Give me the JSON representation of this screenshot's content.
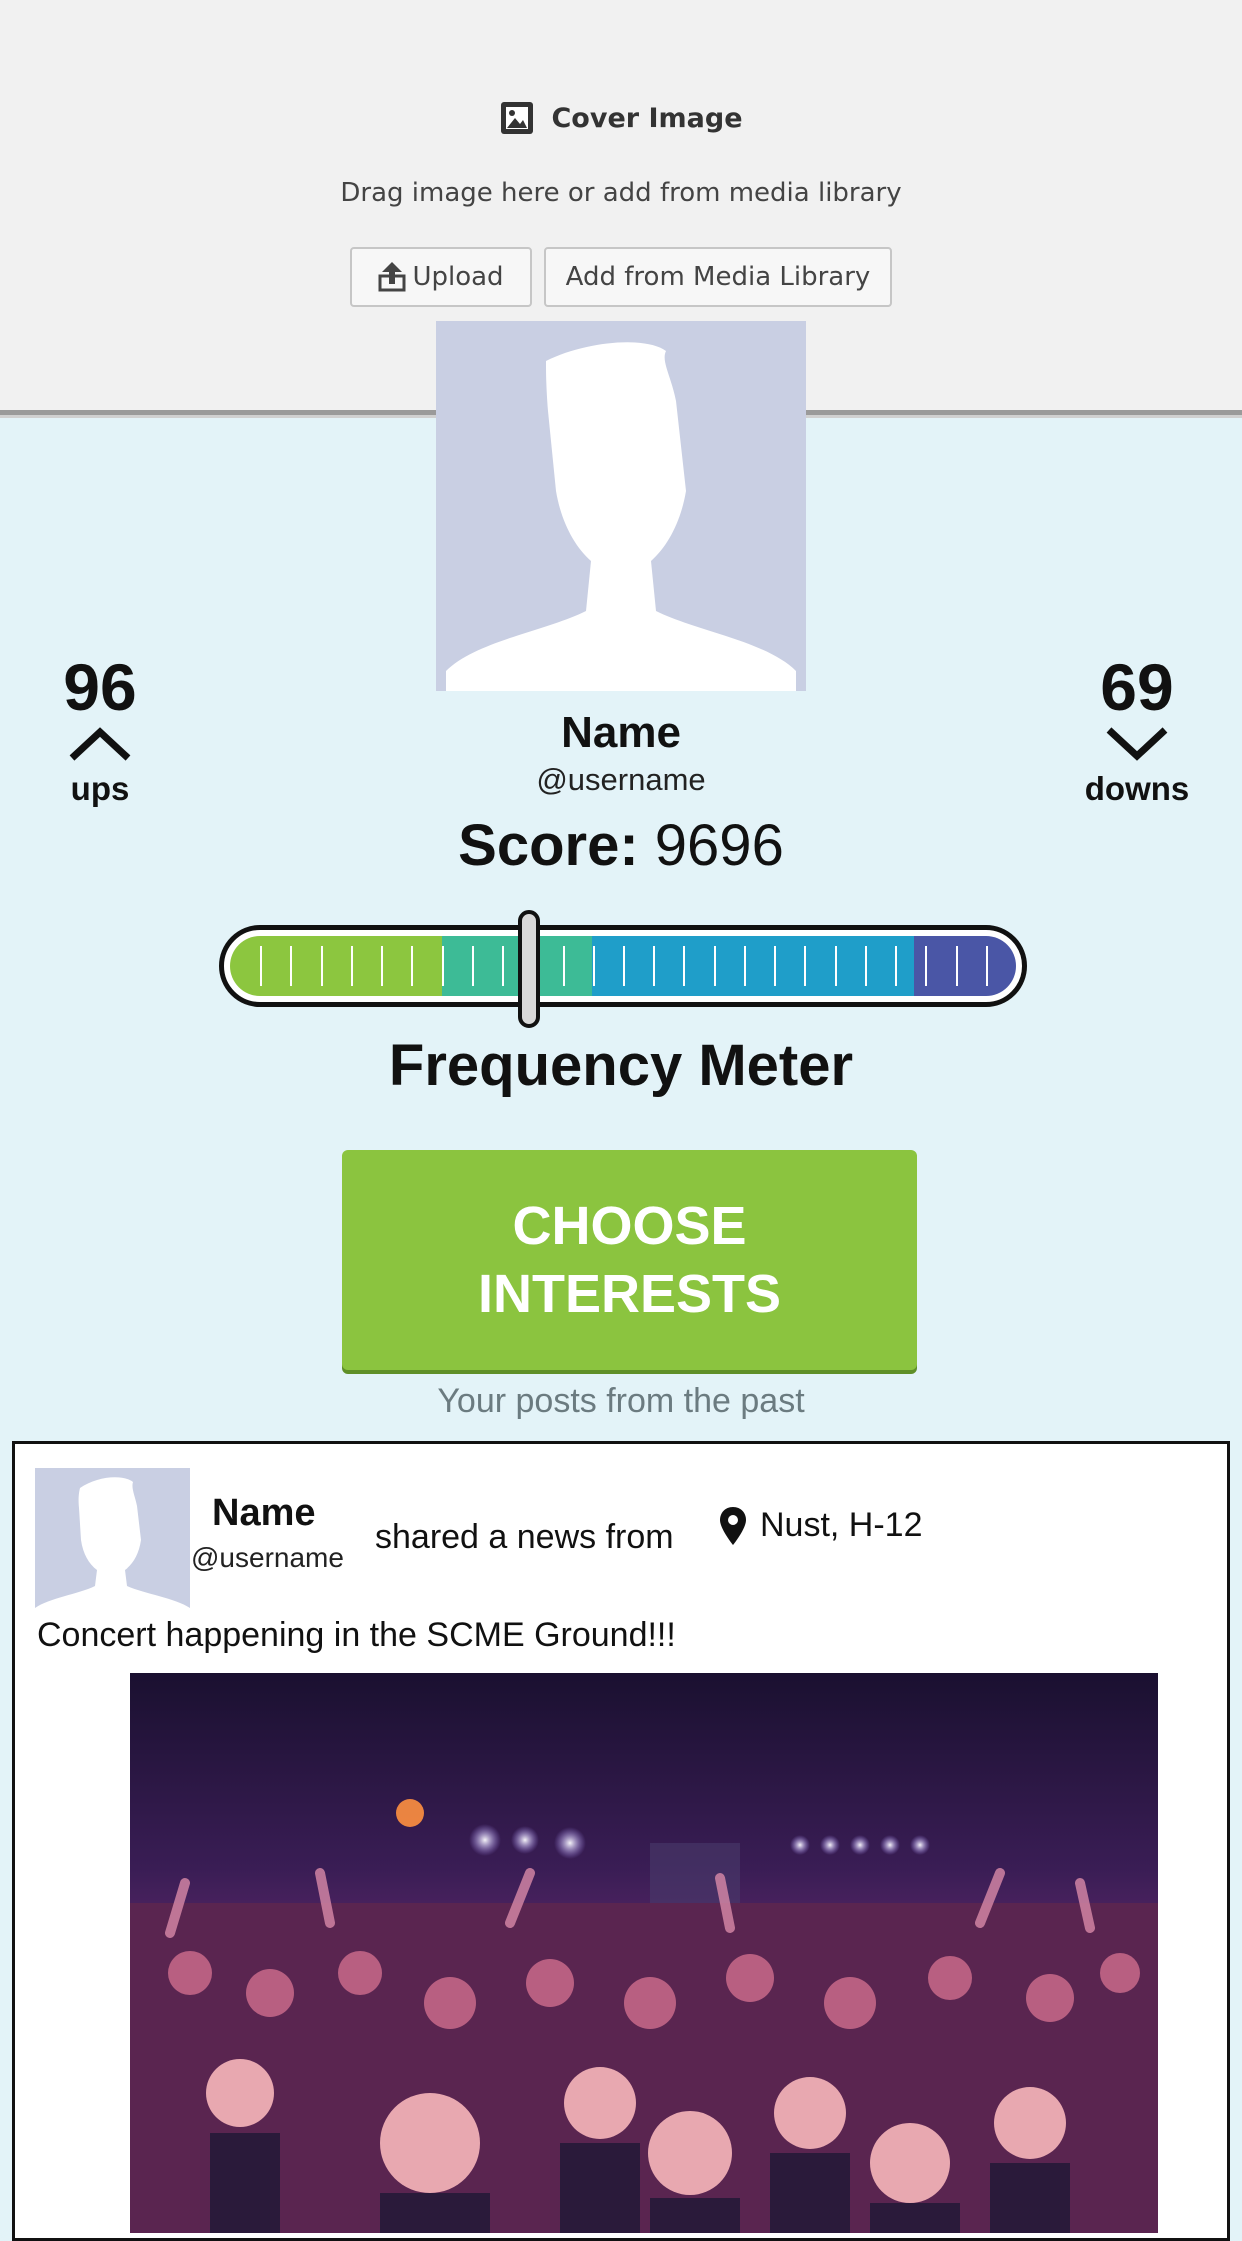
{
  "cover": {
    "title": "Cover Image",
    "hint": "Drag image here or add from media library",
    "upload_label": "Upload",
    "media_label": "Add from Media Library"
  },
  "profile": {
    "name": "Name",
    "username": "@username",
    "score_label": "Score:",
    "score_value": "9696",
    "ups_count": "96",
    "ups_label": "ups",
    "downs_count": "69",
    "downs_label": "downs"
  },
  "meter": {
    "label": "Frequency Meter",
    "needle_fraction": 0.38,
    "colors": [
      "#8cc63f",
      "#3dbb96",
      "#1f9ec9",
      "#4a56a6"
    ]
  },
  "cta": {
    "line1": "CHOOSE",
    "line2": "INTERESTS"
  },
  "past_label": "Your posts from the past",
  "post": {
    "name": "Name",
    "username": "@username",
    "action": "shared a news from",
    "location": "Nust, H-12",
    "text": "Concert happening in the SCME Ground!!!"
  },
  "icons": [
    "image-icon",
    "upload-icon",
    "chevron-up-icon",
    "chevron-down-icon",
    "location-pin-icon"
  ]
}
